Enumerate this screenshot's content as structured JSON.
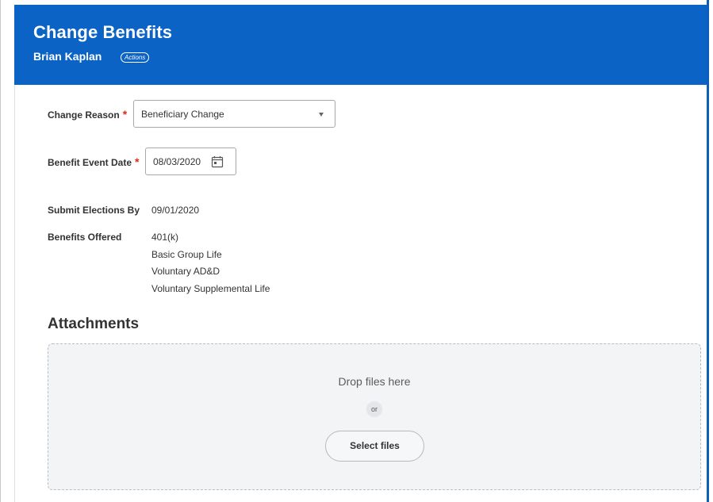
{
  "header": {
    "title": "Change Benefits",
    "worker_name": "Brian Kaplan",
    "actions_label": "Actions"
  },
  "form": {
    "change_reason": {
      "label": "Change Reason",
      "required_mark": "*",
      "value": "Beneficiary Change"
    },
    "benefit_event_date": {
      "label": "Benefit Event Date",
      "required_mark": "*",
      "value": "08/03/2020"
    },
    "submit_elections_by": {
      "label": "Submit Elections By",
      "value": "09/01/2020"
    },
    "benefits_offered": {
      "label": "Benefits Offered",
      "items": [
        "401(k)",
        "Basic Group Life",
        "Voluntary AD&D",
        "Voluntary Supplemental Life"
      ]
    }
  },
  "attachments": {
    "title": "Attachments",
    "drop_text": "Drop files here",
    "or_text": "or",
    "select_files_label": "Select files"
  },
  "colors": {
    "header_blue": "#0b63c6",
    "required_red": "#de2a1f",
    "dropzone_bg": "#f2f4f6"
  },
  "icons": {
    "dropdown": "chevron-down-icon",
    "date_picker": "calendar-icon"
  }
}
